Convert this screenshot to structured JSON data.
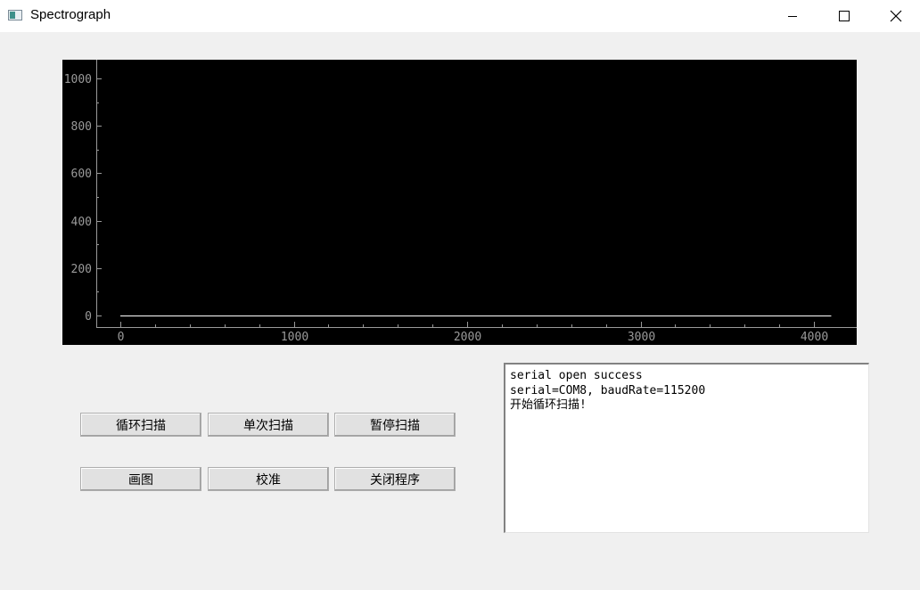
{
  "window": {
    "title": "Spectrograph",
    "icons": {
      "app": "app-window-icon",
      "minimize": "minimize-icon",
      "maximize": "maximize-icon",
      "close": "close-icon"
    }
  },
  "chart_data": {
    "type": "line",
    "title": "",
    "xlabel": "",
    "ylabel": "",
    "xlim": [
      -170,
      4230
    ],
    "ylim": [
      -50,
      1080
    ],
    "x_ticks": [
      0,
      1000,
      2000,
      3000,
      4000
    ],
    "x_tick_labels": [
      "0",
      "1000",
      "2000",
      "3000",
      "4000"
    ],
    "y_ticks": [
      0,
      200,
      400,
      600,
      800,
      1000
    ],
    "y_tick_labels": [
      "0",
      "200",
      "400",
      "600",
      "800",
      "1000"
    ],
    "background": "#000000",
    "grid": false,
    "series": [
      {
        "color": "#ffffff",
        "x": [
          0,
          4100
        ],
        "y": [
          0,
          0
        ]
      }
    ]
  },
  "buttons": {
    "loop_scan": "循环扫描",
    "single_scan": "单次扫描",
    "pause_scan": "暂停扫描",
    "plot": "画图",
    "calibrate": "校准",
    "close_program": "关闭程序"
  },
  "log": {
    "lines": [
      "serial open success",
      "serial=COM8, baudRate=115200",
      "开始循环扫描!"
    ]
  }
}
